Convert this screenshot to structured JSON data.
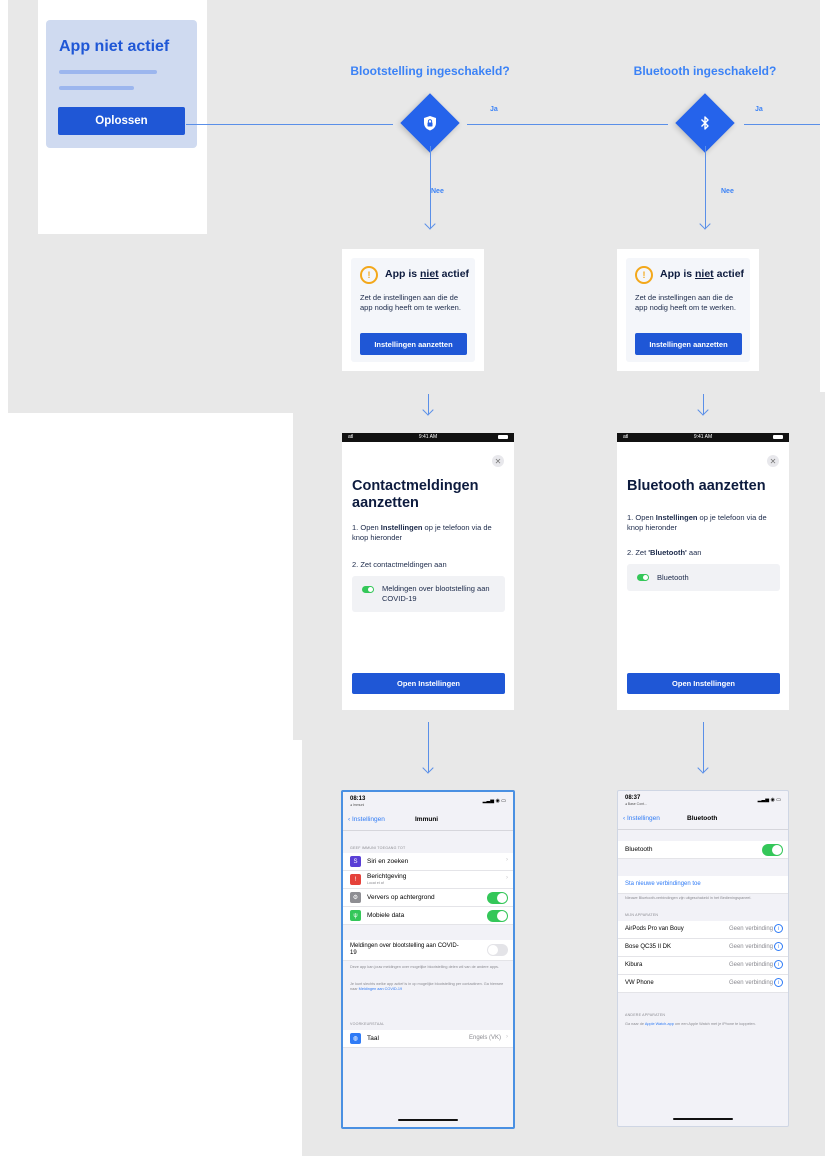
{
  "colors": {
    "accent": "#1f57d6",
    "line": "#5a8fe8",
    "warning": "#f3a81b",
    "toggle_on": "#34c759",
    "background": "#e8e8e8"
  },
  "source_card": {
    "title": "App niet actief",
    "button": "Oplossen"
  },
  "questions": [
    {
      "label": "Blootstelling ingeschakeld?",
      "yes": "Ja",
      "no": "Nee",
      "icon": "shield-lock-icon"
    },
    {
      "label": "Bluetooth ingeschakeld?",
      "yes": "Ja",
      "no": "Nee",
      "icon": "bluetooth-icon"
    }
  ],
  "warning_cards": [
    {
      "title_pre": "App is ",
      "title_em": "niet",
      "title_post": " actief",
      "text": "Zet de instellingen aan die de app nodig heeft om te werken.",
      "button": "Instellingen aanzetten"
    },
    {
      "title_pre": "App is ",
      "title_em": "niet",
      "title_post": " actief",
      "text": "Zet de instellingen aan die de app nodig heeft om te werken.",
      "button": "Instellingen aanzetten"
    }
  ],
  "dialogs": [
    {
      "status_time": "9:41 AM",
      "status_signal": "atl",
      "title": "Contactmeldingen aanzetten",
      "step1_num": "1.",
      "step1_pre": "Open ",
      "step1_bold": "Instellingen",
      "step1_post": " op je telefoon via de knop hieronder",
      "step2": "2. Zet contactmeldingen aan",
      "toggle_label": "Meldingen over blootstelling aan COVID-19",
      "button": "Open Instellingen"
    },
    {
      "status_time": "9:41 AM",
      "status_signal": "atl",
      "title": "Bluetooth aanzetten",
      "step1_num": "1.",
      "step1_pre": "Open ",
      "step1_bold": "Instellingen",
      "step1_post": " op je telefoon via de knop hieronder",
      "step2_pre": "2. Zet ",
      "step2_bold": "'Bluetooth'",
      "step2_post": " aan",
      "toggle_label": "Bluetooth",
      "button": "Open Instellingen"
    }
  ],
  "settings_immuni": {
    "time": "08:13",
    "carrier": "◂ Immuni",
    "status_right": "▂▃▅ ◉ ▭",
    "back": "Instellingen",
    "nav_title": "Immuni",
    "section1": "GEEF IMMUNI TOEGANG TOT",
    "rows": [
      {
        "label": "Siri en zoeken",
        "type": "chevron",
        "icon_color": "#5a3fd6",
        "glyph": "S"
      },
      {
        "label": "Berichtgeving",
        "sublabel": "Locat et af",
        "type": "chevron",
        "icon_color": "#e5413a",
        "glyph": "!"
      },
      {
        "label": "Ververs op achtergrond",
        "type": "toggle_on",
        "icon_color": "#8e8e93",
        "glyph": "⚙"
      },
      {
        "label": "Mobiele data",
        "type": "toggle_on",
        "icon_color": "#34c759",
        "glyph": "ψ"
      }
    ],
    "exposure_label": "Meldingen over blootstelling aan COVID-19",
    "foot1": "Deze app kan jouw meldingen over mogelijke blootstelling delen wil van de andere apps.",
    "foot2_pre": "Je kunt slechts welke app actief is in op mogelijke blootstelling per contactinen. Ga hierwee naar ",
    "foot2_link": "Meldingen aan COVID-19",
    "section2": "VOORKEURSTAAL",
    "lang_label": "Taal",
    "lang_value": "Engels (VK)"
  },
  "settings_bluetooth": {
    "time": "08:37",
    "carrier": "◂ Base Cont...",
    "status_right": "▂▃▅ ◉ ▭",
    "back": "Instellingen",
    "nav_title": "Bluetooth",
    "bt_label": "Bluetooth",
    "new_conn": "Sta nieuwe verbindingen toe",
    "new_conn_foot": "Nieuwe Bluetooth-verbindingen zijn uitgeschakeld in het Bedieningspaneel.",
    "section_mine": "MIJN APPARATEN",
    "devices": [
      {
        "name": "AirPods Pro van Bouy",
        "status": "Geen verbinding"
      },
      {
        "name": "Bose QC35 II DK",
        "status": "Geen verbinding"
      },
      {
        "name": "Kibura",
        "status": "Geen verbinding"
      },
      {
        "name": "VW Phone",
        "status": "Geen verbinding"
      }
    ],
    "section_other": "ANDERE APPARATEN",
    "other_foot_pre": "Ga naar de ",
    "other_foot_link": "Apple Watch-app",
    "other_foot_post": " om een Apple Watch met je iPhone te koppelen."
  }
}
